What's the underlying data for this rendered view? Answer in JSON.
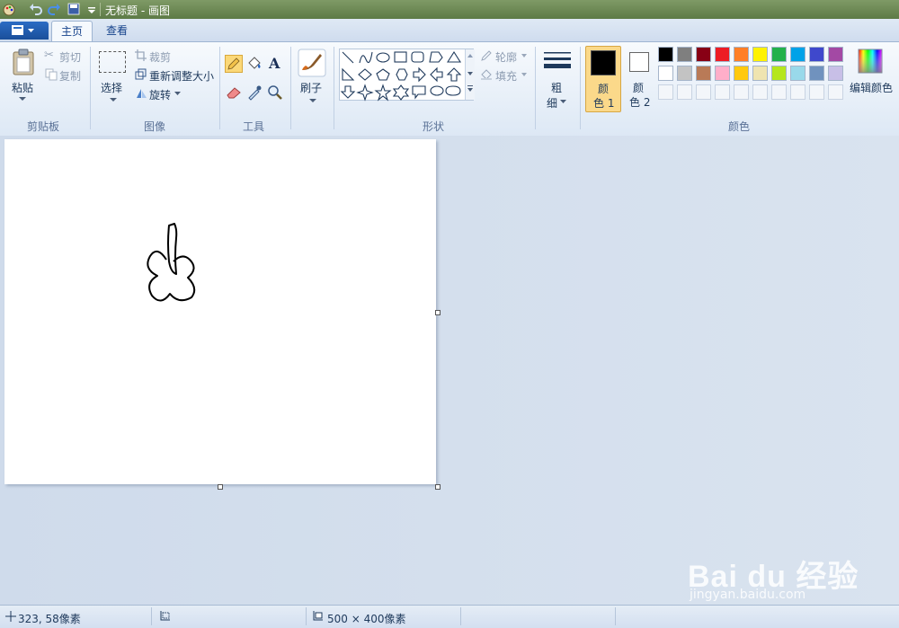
{
  "window": {
    "title": "无标题 - 画图"
  },
  "tabs": [
    {
      "label": "主页"
    },
    {
      "label": "查看"
    }
  ],
  "clipboard": {
    "paste": "粘贴",
    "cut": "剪切",
    "copy": "复制",
    "group": "剪贴板"
  },
  "image": {
    "select": "选择",
    "crop": "裁剪",
    "resize": "重新调整大小",
    "rotate": "旋转",
    "group": "图像"
  },
  "tools": {
    "group": "工具"
  },
  "brushes": {
    "label": "刷子"
  },
  "shapes": {
    "outline": "轮廓",
    "fill": "填充",
    "group": "形状"
  },
  "size": {
    "label_line1": "粗",
    "label_line2": "细"
  },
  "colors": {
    "color1_line1": "颜",
    "color1_line2": "色 1",
    "color2_line1": "颜",
    "color2_line2": "色 2",
    "edit": "编辑颜色",
    "group": "颜色",
    "primary": "#000000",
    "secondary": "#ffffff",
    "row1": [
      "#000000",
      "#7f7f7f",
      "#880015",
      "#ed1c24",
      "#ff7f27",
      "#fff200",
      "#22b14c",
      "#00a2e8",
      "#3f48cc",
      "#a349a4"
    ],
    "row2": [
      "#ffffff",
      "#c3c3c3",
      "#b97a57",
      "#ffaec9",
      "#ffc90e",
      "#efe4b0",
      "#b5e61d",
      "#99d9ea",
      "#7092be",
      "#c8bfe7"
    ]
  },
  "status": {
    "cursor": "323, 58像素",
    "image_size": "500 × 400像素"
  },
  "watermark": {
    "brand": "Bai du 经验",
    "url": "jingyan.baidu.com"
  }
}
